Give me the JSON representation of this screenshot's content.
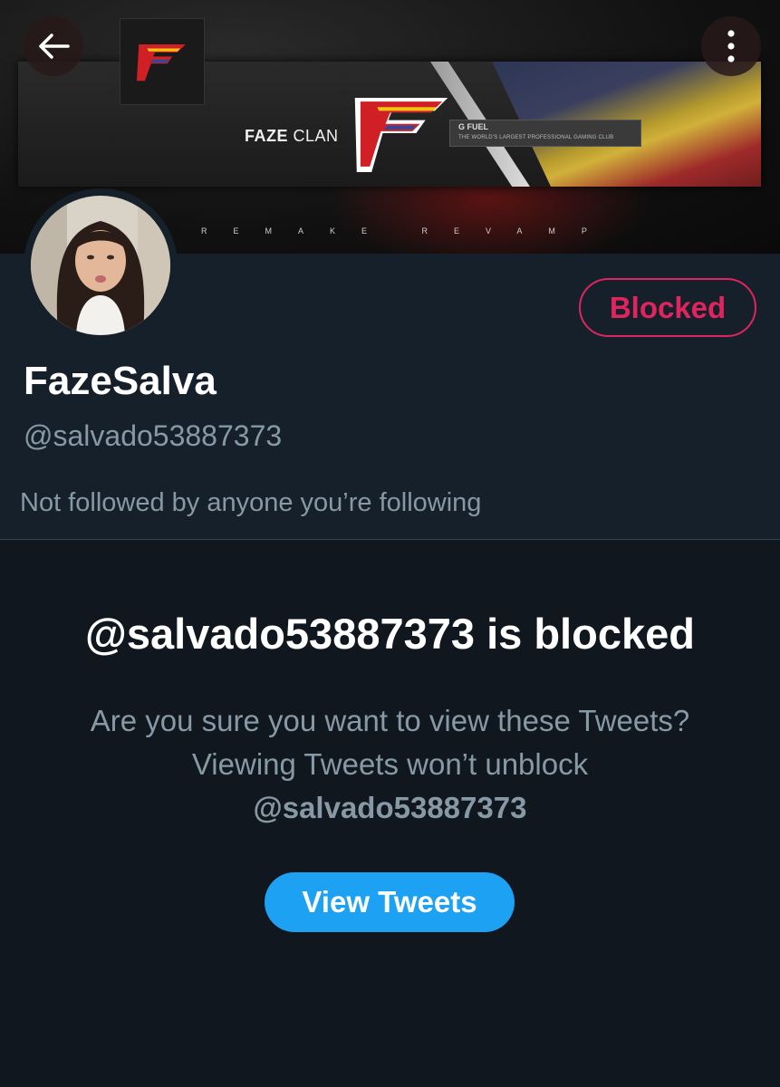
{
  "header": {
    "banner_brand_bold": "FAZE",
    "banner_brand_light": "CLAN",
    "banner_sponsor": "G FUEL",
    "banner_sponsor_tagline": "THE WORLD'S LARGEST PROFESSIONAL GAMING CLUB",
    "banner_caption": "REMAKE REVAMP",
    "back_icon": "arrow-left-icon",
    "more_icon": "more-vertical-icon"
  },
  "profile": {
    "display_name": "FazeSalva",
    "handle": "@salvado53887373",
    "blocked_label": "Blocked",
    "followers_note": "Not followed by anyone you’re following"
  },
  "blocked_notice": {
    "title": "@salvado53887373 is blocked",
    "message": "Are you sure you want to view these Tweets? Viewing Tweets won’t unblock",
    "message_handle": "@salvado53887373",
    "view_button": "View Tweets"
  },
  "colors": {
    "background": "#15202b",
    "lower_background": "#10171e",
    "accent_blue": "#1da1f2",
    "blocked_red": "#e0245e",
    "muted_text": "#8899a6"
  }
}
